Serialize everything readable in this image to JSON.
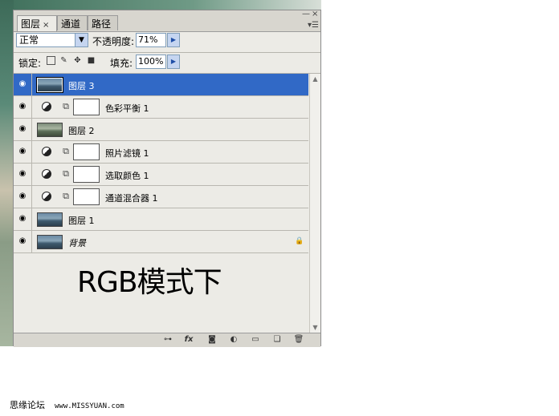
{
  "tabs": [
    {
      "label": "图层",
      "close": "×"
    },
    {
      "label": "通道"
    },
    {
      "label": "路径"
    }
  ],
  "window_controls": {
    "minimize": "—",
    "close": "×",
    "menu": "▾☰"
  },
  "blend_mode": {
    "value": "正常"
  },
  "opacity": {
    "label": "不透明度:",
    "value": "71%"
  },
  "lock": {
    "label": "锁定:"
  },
  "fill": {
    "label": "填充:",
    "value": "100%"
  },
  "layers": [
    {
      "name": "图层 3",
      "kind": "pixel",
      "selected": true
    },
    {
      "name": "色彩平衡 1",
      "kind": "adjustment"
    },
    {
      "name": "图层 2",
      "kind": "pixel"
    },
    {
      "name": "照片滤镜 1",
      "kind": "adjustment"
    },
    {
      "name": "选取颜色 1",
      "kind": "adjustment"
    },
    {
      "name": "通道混合器 1",
      "kind": "adjustment"
    },
    {
      "name": "图层 1",
      "kind": "pixel"
    },
    {
      "name": "背景",
      "kind": "background",
      "locked": true
    }
  ],
  "overlay_text": "RGB模式下",
  "bottom_icons": [
    "link-icon",
    "fx-icon",
    "mask-icon",
    "adjustment-icon",
    "folder-icon",
    "new-layer-icon",
    "trash-icon"
  ],
  "fx_label": "fx",
  "footer": {
    "site": "思缘论坛",
    "url": "www.MISSYUAN.com"
  },
  "colors": {
    "selection": "#3169c6",
    "panel": "#ecebe6"
  }
}
